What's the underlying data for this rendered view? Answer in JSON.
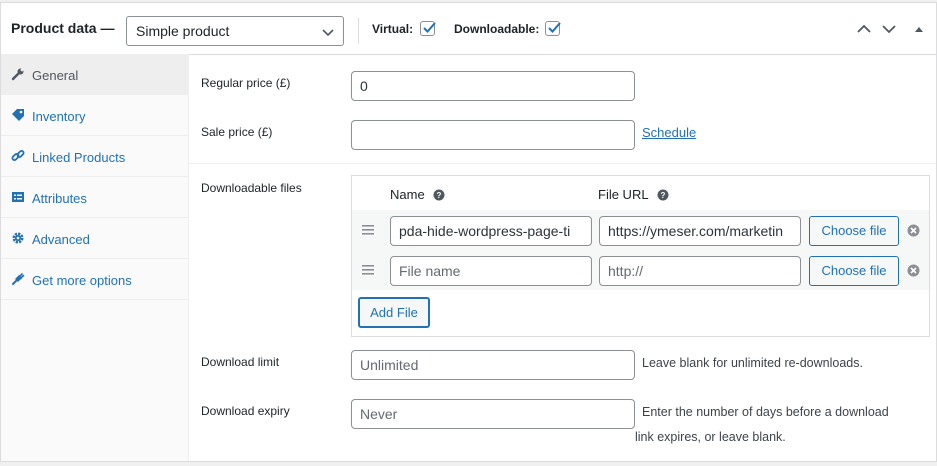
{
  "header": {
    "title": "Product data —",
    "product_type": "Simple product",
    "virtual_label": "Virtual:",
    "virtual_checked": true,
    "downloadable_label": "Downloadable:",
    "downloadable_checked": true
  },
  "sidebar": {
    "items": [
      {
        "label": "General",
        "icon": "wrench-icon",
        "active": true
      },
      {
        "label": "Inventory",
        "icon": "tag-icon",
        "active": false
      },
      {
        "label": "Linked Products",
        "icon": "link-icon",
        "active": false
      },
      {
        "label": "Attributes",
        "icon": "list-icon",
        "active": false
      },
      {
        "label": "Advanced",
        "icon": "gear-icon",
        "active": false
      },
      {
        "label": "Get more options",
        "icon": "plugin-icon",
        "active": false
      }
    ]
  },
  "general": {
    "regular_price_label": "Regular price (£)",
    "regular_price_value": "0",
    "sale_price_label": "Sale price (£)",
    "sale_price_value": "",
    "schedule_link": "Schedule"
  },
  "downloads": {
    "label": "Downloadable files",
    "col_name": "Name",
    "col_url": "File URL",
    "files": [
      {
        "name": "pda-hide-wordpress-page-ti",
        "url": "https://ymeser.com/marketin",
        "name_placeholder": "File name",
        "url_placeholder": "http://"
      },
      {
        "name": "",
        "url": "",
        "name_placeholder": "File name",
        "url_placeholder": "http://"
      }
    ],
    "choose_file_label": "Choose file",
    "add_file_label": "Add File",
    "limit_label": "Download limit",
    "limit_placeholder": "Unlimited",
    "limit_hint": "Leave blank for unlimited re-downloads.",
    "expiry_label": "Download expiry",
    "expiry_placeholder": "Never",
    "expiry_hint_1": "Enter the number of days before a download",
    "expiry_hint_2": "link expires, or leave blank."
  },
  "colors": {
    "accent": "#2271b1",
    "border": "#8c8f94"
  }
}
